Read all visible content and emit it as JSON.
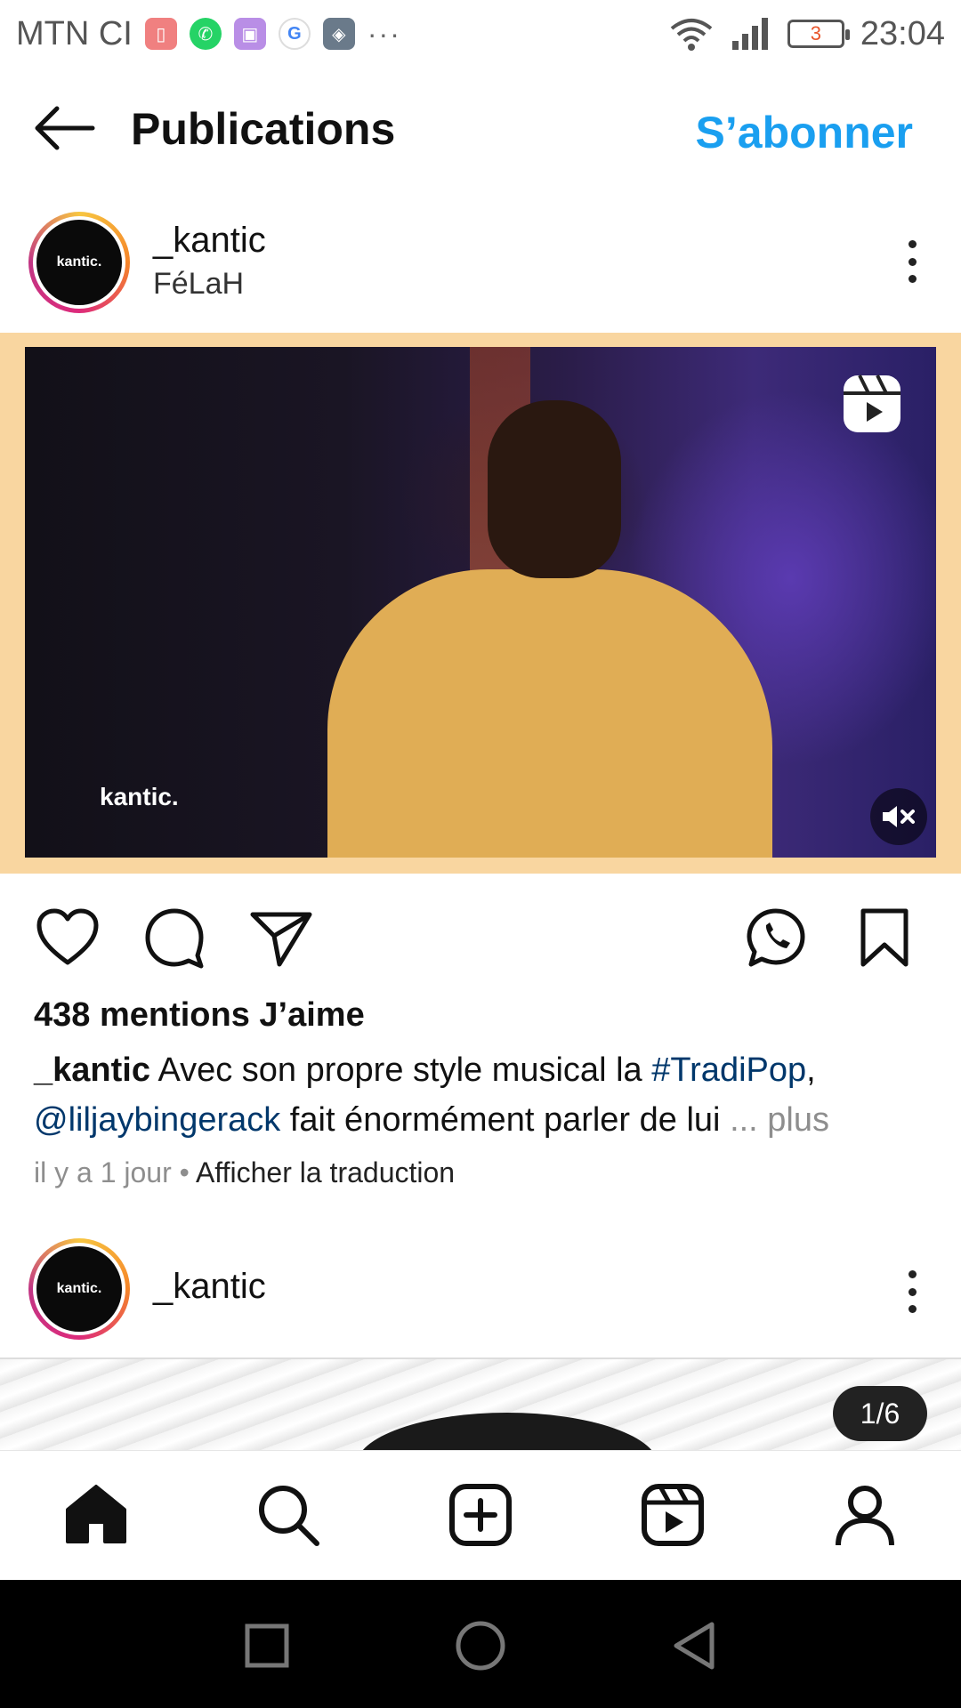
{
  "status_bar": {
    "carrier": "MTN CI",
    "more": "···",
    "battery": "3",
    "time": "23:04"
  },
  "header": {
    "title": "Publications",
    "follow_label": "S’abonner"
  },
  "post": {
    "username": "_kantic",
    "subtitle": "FéLaH",
    "avatar_text": "kantic.",
    "watermark": "kantic.",
    "likes": "438 mentions J’aime",
    "caption": {
      "username": "_kantic",
      "text_1": "Avec son propre style musical la ",
      "hashtag": "#TradiPop",
      "text_2": ",",
      "mention": "@liljaybingerack",
      "text_3": " fait énormément parler de lui ",
      "more": "... plus"
    },
    "time_ago": "il y a 1 jour",
    "separator": " • ",
    "translate": "Afficher la traduction"
  },
  "next_post": {
    "username": "_kantic",
    "avatar_text": "kantic.",
    "counter": "1/6"
  },
  "colors": {
    "accent": "#1a9ff0",
    "link": "#00376b",
    "muted": "#8e8e8e"
  },
  "icons": {
    "status": [
      "battery-app-icon",
      "whatsapp-icon",
      "gallery-icon",
      "google-icon",
      "game-icon"
    ],
    "actions": [
      "heart-icon",
      "comment-icon",
      "send-icon",
      "whatsapp-icon",
      "bookmark-icon"
    ],
    "nav": [
      "home-icon",
      "search-icon",
      "create-icon",
      "reels-icon",
      "profile-icon"
    ],
    "system": [
      "recent-apps-icon",
      "home-circle-icon",
      "back-triangle-icon"
    ]
  }
}
